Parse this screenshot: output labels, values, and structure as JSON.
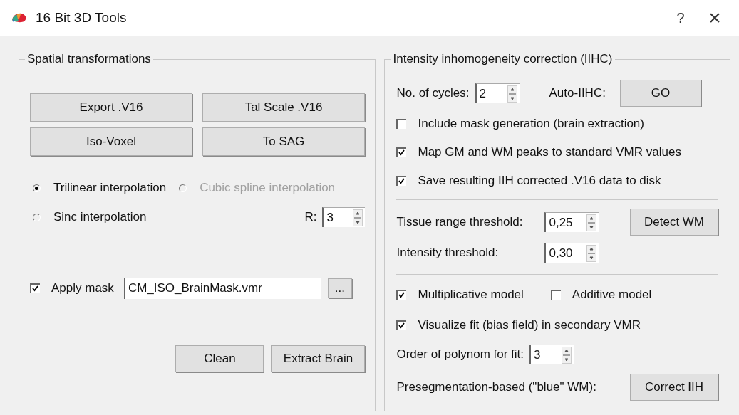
{
  "window": {
    "title": "16 Bit 3D Tools",
    "help": "?",
    "close": "×"
  },
  "spatial": {
    "title": "Spatial transformations",
    "buttons": [
      {
        "label": "Export .V16"
      },
      {
        "label": "Tal Scale .V16"
      },
      {
        "label": "Iso-Voxel"
      },
      {
        "label": "To SAG"
      }
    ],
    "interpolation": [
      {
        "label": "Trilinear interpolation",
        "selected": true,
        "disabled": false
      },
      {
        "label": "Cubic spline interpolation",
        "selected": false,
        "disabled": true
      },
      {
        "label": "Sinc interpolation",
        "selected": false,
        "disabled": false
      }
    ],
    "r_label": "R:",
    "r_value": "3",
    "apply_mask": {
      "label": "Apply mask",
      "checked": true,
      "value": "CM_ISO_BrainMask.vmr",
      "browse": "..."
    },
    "actions": [
      {
        "label": "Clean"
      },
      {
        "label": "Extract Brain"
      }
    ]
  },
  "iihc": {
    "title": "Intensity inhomogeneity correction (IIHC)",
    "cycles_label": "No. of cycles:",
    "cycles_value": "2",
    "auto_label": "Auto-IIHC:",
    "go": "GO",
    "options": [
      {
        "label": "Include mask generation (brain extraction)",
        "checked": false
      },
      {
        "label": "Map GM and WM peaks to standard VMR values",
        "checked": true
      },
      {
        "label": "Save resulting IIH corrected .V16 data to disk",
        "checked": true
      }
    ],
    "tissue_label": "Tissue range threshold:",
    "tissue_value": "0,25",
    "detect": "Detect WM",
    "intensity_label": "Intensity threshold:",
    "intensity_value": "0,30",
    "models": [
      {
        "label": "Multiplicative model",
        "checked": true
      },
      {
        "label": "Additive model",
        "checked": false
      }
    ],
    "visualize": {
      "label": "Visualize fit (bias field) in secondary VMR",
      "checked": true
    },
    "order_label": "Order of polynom for fit:",
    "order_value": "3",
    "preseg_label": "Presegmentation-based (\"blue\" WM):",
    "correct": "Correct IIH"
  }
}
